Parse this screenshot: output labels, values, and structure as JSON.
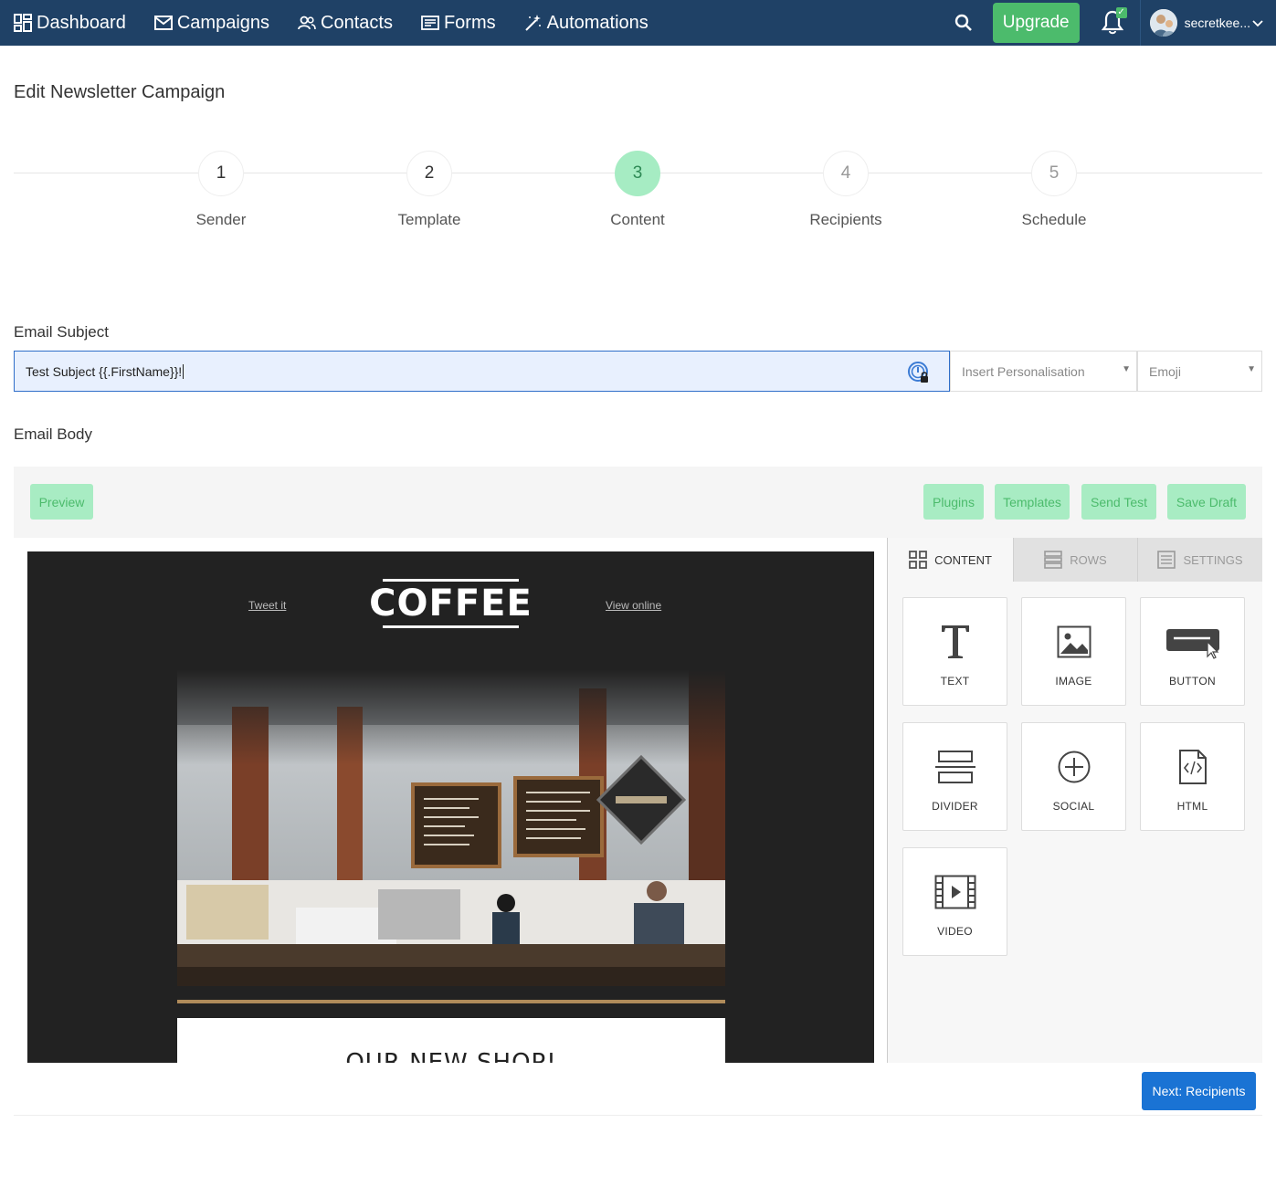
{
  "nav": {
    "items": [
      {
        "label": "Dashboard",
        "icon": "dashboard-icon"
      },
      {
        "label": "Campaigns",
        "icon": "envelope-icon"
      },
      {
        "label": "Contacts",
        "icon": "users-icon"
      },
      {
        "label": "Forms",
        "icon": "form-icon"
      },
      {
        "label": "Automations",
        "icon": "magic-wand-icon"
      }
    ],
    "upgrade_label": "Upgrade",
    "username": "secretkee...",
    "colors": {
      "bar": "#1f4166",
      "upgrade": "#4cbb6c"
    }
  },
  "page": {
    "title": "Edit Newsletter Campaign"
  },
  "steps": [
    {
      "number": "1",
      "label": "Sender"
    },
    {
      "number": "2",
      "label": "Template"
    },
    {
      "number": "3",
      "label": "Content"
    },
    {
      "number": "4",
      "label": "Recipients"
    },
    {
      "number": "5",
      "label": "Schedule"
    }
  ],
  "active_step": "3",
  "subject": {
    "label": "Email Subject",
    "value": "Test Subject {{.FirstName}}!",
    "personalisation_placeholder": "Insert Personalisation",
    "emoji_placeholder": "Emoji"
  },
  "body": {
    "label": "Email Body"
  },
  "toolbar": {
    "preview_label": "Preview",
    "plugins_label": "Plugins",
    "templates_label": "Templates",
    "send_test_label": "Send Test",
    "save_draft_label": "Save Draft"
  },
  "email": {
    "tweet_label": "Tweet it",
    "logo_text": "COFFEE",
    "view_online_label": "View online",
    "section_title": "OUR NEW SHOP!"
  },
  "panel": {
    "tabs": [
      "CONTENT",
      "ROWS",
      "SETTINGS"
    ],
    "tiles": [
      "TEXT",
      "IMAGE",
      "BUTTON",
      "DIVIDER",
      "SOCIAL",
      "HTML",
      "VIDEO"
    ]
  },
  "footer": {
    "next_label": "Next: Recipients"
  }
}
